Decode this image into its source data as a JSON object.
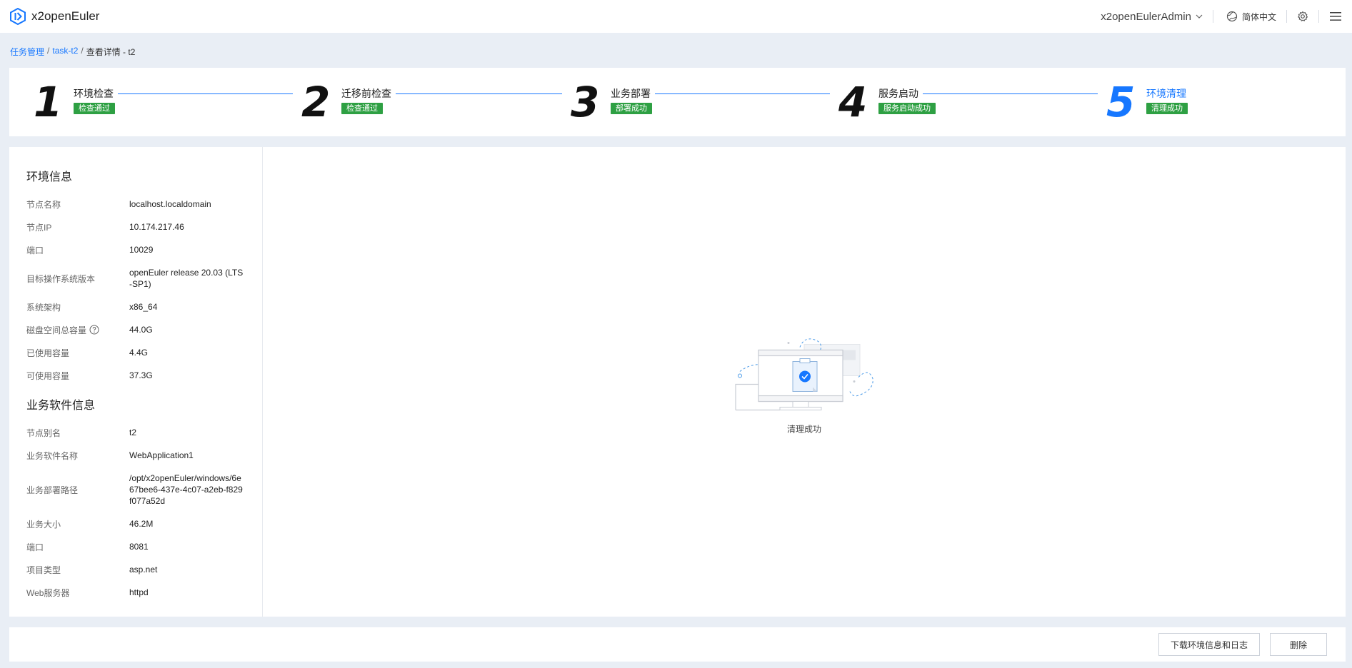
{
  "app": {
    "name": "x2openEuler"
  },
  "header": {
    "user": "x2openEulerAdmin",
    "language": "简体中文",
    "icons": {
      "logo": "app-logo-icon",
      "language": "globe-icon",
      "settings": "gear-icon",
      "menu": "hamburger-menu-icon"
    }
  },
  "breadcrumb": {
    "items": [
      "任务管理",
      "task-t2",
      "查看详情 - t2"
    ],
    "separator": "/"
  },
  "steps": [
    {
      "number": "1",
      "title": "环境检查",
      "status": "检查通过"
    },
    {
      "number": "2",
      "title": "迁移前检查",
      "status": "检查通过"
    },
    {
      "number": "3",
      "title": "业务部署",
      "status": "部署成功"
    },
    {
      "number": "4",
      "title": "服务启动",
      "status": "服务启动成功"
    },
    {
      "number": "5",
      "title": "环境清理",
      "status": "清理成功"
    }
  ],
  "colors": {
    "accent": "#1677ff",
    "success": "#2ea043",
    "background": "#e9eef5"
  },
  "env_info": {
    "title": "环境信息",
    "rows": [
      {
        "label": "节点名称",
        "value": "localhost.localdomain"
      },
      {
        "label": "节点IP",
        "value": "10.174.217.46"
      },
      {
        "label": "端口",
        "value": "10029"
      },
      {
        "label": "目标操作系统版本",
        "value": "openEuler release 20.03 (LTS-SP1)"
      },
      {
        "label": "系统架构",
        "value": "x86_64"
      },
      {
        "label": "磁盘空间总容量",
        "value": "44.0G"
      },
      {
        "label": "已使用容量",
        "value": "4.4G"
      },
      {
        "label": "可使用容量",
        "value": "37.3G"
      }
    ]
  },
  "software_info": {
    "title": "业务软件信息",
    "rows": [
      {
        "label": "节点别名",
        "value": "t2"
      },
      {
        "label": "业务软件名称",
        "value": "WebApplication1"
      },
      {
        "label": "业务部署路径",
        "value": "/opt/x2openEuler/windows/6e67bee6-437e-4c07-a2eb-f829f077a52d"
      },
      {
        "label": "业务大小",
        "value": "46.2M"
      },
      {
        "label": "端口",
        "value": "8081"
      },
      {
        "label": "项目类型",
        "value": "asp.net"
      },
      {
        "label": "Web服务器",
        "value": "httpd"
      }
    ]
  },
  "result": {
    "text": "清理成功",
    "icon": "cleanup-success-illustration"
  },
  "footer": {
    "download_label": "下载环境信息和日志",
    "delete_label": "删除"
  }
}
